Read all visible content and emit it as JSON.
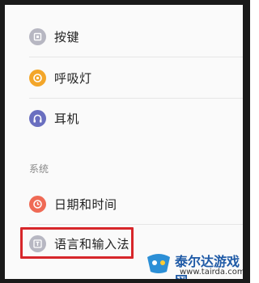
{
  "settings": {
    "items": [
      {
        "label": "按键",
        "icon": "key-button-icon",
        "color": "#b7b7c2"
      },
      {
        "label": "呼吸灯",
        "icon": "breathing-light-icon",
        "color": "#f3a62a"
      },
      {
        "label": "耳机",
        "icon": "headphones-icon",
        "color": "#6a6fc0"
      }
    ],
    "section_title": "系统",
    "system_items": [
      {
        "label": "日期和时间",
        "icon": "clock-icon",
        "color": "#ef6a55"
      },
      {
        "label": "语言和输入法",
        "icon": "language-input-icon",
        "color": "#b7b7c2"
      }
    ]
  },
  "watermark": {
    "brand": "泰尔达游戏网",
    "url": "www.tairda.com"
  },
  "colors": {
    "highlight": "#d7262a",
    "divider": "#e6e6e6",
    "section_text": "#8a8a8a"
  }
}
